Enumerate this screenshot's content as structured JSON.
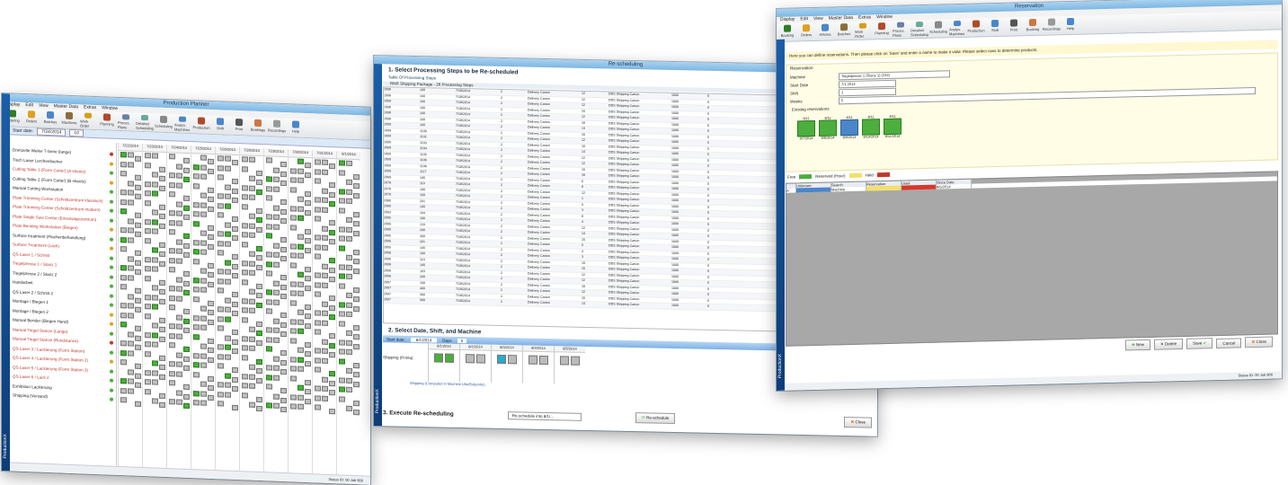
{
  "left_window": {
    "title": "Production Planner",
    "menu": [
      "Display",
      "Edit",
      "View",
      "Master Data",
      "Extras",
      "Window"
    ],
    "ribbon": [
      {
        "label": "Ordering",
        "color": "#2e7d25"
      },
      {
        "label": "Orders",
        "color": "#e0a020"
      },
      {
        "label": "Batches",
        "color": "#4b86c9"
      },
      {
        "label": "Machines",
        "color": "#8a6d3b"
      },
      {
        "label": "Work Order",
        "color": "#d4a017"
      },
      {
        "label": "Planning",
        "color": "#b04a2a"
      },
      {
        "label": "Proces. Plans",
        "color": "#6a7fa6"
      },
      {
        "label": "Detailed Scheduling",
        "color": "#6a9"
      },
      {
        "label": "Scheduling",
        "color": "#888"
      },
      {
        "label": "Analys. Machines",
        "color": "#4b86c9"
      },
      {
        "label": "Production",
        "color": "#b04a2a"
      },
      {
        "label": "Shift",
        "color": "#4b86c9"
      },
      {
        "label": "Print",
        "color": "#555"
      },
      {
        "label": "Bookings",
        "color": "#c74"
      },
      {
        "label": "Recordings",
        "color": "#999"
      },
      {
        "label": "Help",
        "color": "#4b86c9"
      }
    ],
    "toolbar": {
      "start_label": "Start date:",
      "start_value": "7/24/2014",
      "days_value": "10"
    },
    "dates": [
      "7/22/2014",
      "7/23/2014",
      "7/24/2014",
      "7/25/2014",
      "7/26/2014",
      "7/28/2014",
      "7/29/2014",
      "7/30/2014",
      "7/31/2014",
      "8/1/2014"
    ],
    "rows": [
      {
        "label": "Drehzelle Weiler T-Serie (lange)",
        "red": false,
        "dot": "#c0392b"
      },
      {
        "label": "Tisch Laser Lerchenbacher",
        "red": false,
        "dot": "#e0a020"
      },
      {
        "label": "Cutting Table 1 (Form Cutter) (A sheets)",
        "red": true,
        "dot": "#4cae3c"
      },
      {
        "label": "Cutting Table 2 (Form Cutter) (B sheets)",
        "red": false,
        "dot": "#e0a020"
      },
      {
        "label": "Manual Cutting Workstation",
        "red": false,
        "dot": "#4cae3c"
      },
      {
        "label": "Plate Trimming Center (Schnittzentrum klassisch)",
        "red": true,
        "dot": "#4cae3c"
      },
      {
        "label": "Plate Trimming Center (Schnittzentrum modern)",
        "red": true,
        "dot": "#4cae3c"
      },
      {
        "label": "Plate Single Saw Center (Einzelsägezentrum)",
        "red": true,
        "dot": "#4cae3c"
      },
      {
        "label": "Plate Bending Workstation (Biegen)",
        "red": true,
        "dot": "#e0a020"
      },
      {
        "label": "Surface treatment (Flachenbehandlung)",
        "red": false,
        "dot": "#4cae3c"
      },
      {
        "label": "Surface Treatment (Lack)",
        "red": true,
        "dot": "#e0a020"
      },
      {
        "label": "QS Laser 1 / Schnitt",
        "red": true,
        "dot": "#4cae3c"
      },
      {
        "label": "Tiegelpresse 1 / Stanz 1",
        "red": true,
        "dot": "#4cae3c"
      },
      {
        "label": "Tiegelpresse 2 / Stanz 2",
        "red": false,
        "dot": "#4cae3c"
      },
      {
        "label": "Handarbeit",
        "red": false,
        "dot": "#4cae3c"
      },
      {
        "label": "QS Laser 2 / Schnitt 2",
        "red": false,
        "dot": "#4cae3c"
      },
      {
        "label": "Montage / Biegen 1",
        "red": false,
        "dot": "#4cae3c"
      },
      {
        "label": "Montage / Biegen 2",
        "red": false,
        "dot": "#e0a020"
      },
      {
        "label": "Manual Bender (Biegen Hand)",
        "red": false,
        "dot": "#e0a020"
      },
      {
        "label": "Manual Tiegel Stanze (Lange)",
        "red": true,
        "dot": "#4cae3c"
      },
      {
        "label": "Manual Tiegel Stanze (Rundstanze)",
        "red": true,
        "dot": "#c0392b"
      },
      {
        "label": "QS Laser 3 / Lackierung (Form Station)",
        "red": true,
        "dot": "#4cae3c"
      },
      {
        "label": "QS Laser 4 / Lackierung (Form Station 2)",
        "red": true,
        "dot": "#e0a020"
      },
      {
        "label": "QS Laser 5 / Lackierung (Form Station 3)",
        "red": true,
        "dot": "#4cae3c"
      },
      {
        "label": "QS Laser 6 / Lack 2",
        "red": true,
        "dot": "#4cae3c"
      },
      {
        "label": "Exhibition Lackierung",
        "red": false,
        "dot": "#4cae3c"
      },
      {
        "label": "Shipping (Versand)",
        "red": false,
        "dot": "#4cae3c"
      }
    ],
    "sidebar_label": "ProductionX",
    "status": "Status ID: 00   Job 800"
  },
  "middle_window": {
    "title": "Re-scheduling",
    "section1": "1. Select Processing Steps to be Re-scheduled",
    "tab1": "Table Of Processing Steps",
    "group": "RNR Shipping Package - 26 Processing Steps",
    "columns": [
      "ID",
      "Qty",
      "Date",
      "Shift",
      "Machine",
      "Count",
      "Order",
      "Work Step",
      "Time",
      "Flag"
    ],
    "rows": [
      [
        "1006",
        "100",
        "7/18/2014",
        "2",
        "Delivery Carton",
        "12",
        "DDS Shipping Carton",
        "1000",
        "0"
      ],
      [
        "1008",
        "100",
        "7/18/2014",
        "2",
        "Delivery Carton",
        "12",
        "DDS Shipping Carton",
        "1000",
        "0"
      ],
      [
        "1009",
        "100",
        "7/18/2014",
        "2",
        "Delivery Carton",
        "12",
        "DDS Shipping Carton",
        "1000",
        "0"
      ],
      [
        "1008",
        "100",
        "7/18/2014",
        "2",
        "Delivery Carton",
        "15",
        "DDS Shipping Carton",
        "1000",
        "0"
      ],
      [
        "1008",
        "100",
        "7/18/2014",
        "2",
        "Delivery Carton",
        "12",
        "DDS Shipping Carton",
        "1000",
        "0"
      ],
      [
        "1008",
        "100",
        "7/18/2014",
        "2",
        "Delivery Carton",
        "16",
        "DDS Shipping Carton",
        "1000",
        "0"
      ],
      [
        "1009",
        "100",
        "7/18/2014",
        "2",
        "Delivery Carton",
        "13",
        "DDS Shipping Carton",
        "1000",
        "0"
      ],
      [
        "1009",
        "1100",
        "7/18/2014",
        "2",
        "Delivery Carton",
        "16",
        "DDS Shipping Carton",
        "1000",
        "0"
      ],
      [
        "1009",
        "1102",
        "7/18/2014",
        "2",
        "Delivery Carton",
        "12",
        "DDS Shipping Carton",
        "1000",
        "0"
      ],
      [
        "1009",
        "1103",
        "7/18/2014",
        "2",
        "Delivery Carton",
        "16",
        "DDS Shipping Carton",
        "1000",
        "0"
      ],
      [
        "1009",
        "1104",
        "7/18/2014",
        "2",
        "Delivery Carton",
        "14",
        "DDS Shipping Carton",
        "1000",
        "0"
      ],
      [
        "1009",
        "1105",
        "7/18/2014",
        "2",
        "Delivery Carton",
        "12",
        "DDS Shipping Carton",
        "1000",
        "0"
      ],
      [
        "1009",
        "1106",
        "7/18/2014",
        "2",
        "Delivery Carton",
        "12",
        "DDS Shipping Carton",
        "1000",
        "0"
      ],
      [
        "1009",
        "1108",
        "7/18/2014",
        "2",
        "Delivery Carton",
        "15",
        "DDS Shipping Carton",
        "1000",
        "0"
      ],
      [
        "1009",
        "1117",
        "7/18/2014",
        "2",
        "Delivery Carton",
        "16",
        "DDS Shipping Carton",
        "1000",
        "0"
      ],
      [
        "2069",
        "105",
        "7/18/2014",
        "2",
        "Delivery Carton",
        "5",
        "DDS Shipping Carton",
        "1000",
        "0"
      ],
      [
        "2076",
        "110",
        "7/18/2014",
        "2",
        "Delivery Carton",
        "6",
        "DDS Shipping Carton",
        "1000",
        "0"
      ],
      [
        "2076",
        "100",
        "7/18/2014",
        "2",
        "Delivery Carton",
        "12",
        "DDS Shipping Carton",
        "1000",
        "0"
      ],
      [
        "2076",
        "150",
        "7/18/2014",
        "2",
        "Delivery Carton",
        "1",
        "DDS Shipping Carton",
        "1000",
        "0"
      ],
      [
        "2080",
        "201",
        "7/18/2014",
        "2",
        "Delivery Carton",
        "5",
        "DDS Shipping Carton",
        "1000",
        "0"
      ],
      [
        "2000",
        "100",
        "7/18/2014",
        "2",
        "Delivery Carton",
        "3",
        "DDS Shipping Carton",
        "1000",
        "0"
      ],
      [
        "2003",
        "104",
        "7/18/2014",
        "2",
        "Delivery Carton",
        "8",
        "DDS Shipping Carton",
        "1000",
        "0"
      ],
      [
        "2005",
        "100",
        "7/18/2014",
        "2",
        "Delivery Carton",
        "4",
        "DDS Shipping Carton",
        "1000",
        "0"
      ],
      [
        "2005",
        "120",
        "7/18/2014",
        "2",
        "Delivery Carton",
        "12",
        "DDS Shipping Carton",
        "1000",
        "0"
      ],
      [
        "2000",
        "200",
        "7/18/2014",
        "2",
        "Delivery Carton",
        "14",
        "DDS Shipping Carton",
        "1000",
        "0"
      ],
      [
        "2005",
        "300",
        "7/18/2014",
        "2",
        "Delivery Carton",
        "15",
        "DDS Shipping Carton",
        "1000",
        "0"
      ],
      [
        "2005",
        "201",
        "7/18/2014",
        "2",
        "Delivery Carton",
        "5",
        "DDS Shipping Carton",
        "1000",
        "0"
      ],
      [
        "2005",
        "105",
        "7/18/2014",
        "2",
        "Delivery Carton",
        "4",
        "DDS Shipping Carton",
        "1000",
        "0"
      ],
      [
        "2006",
        "100",
        "7/18/2014",
        "2",
        "Delivery Carton",
        "3",
        "DDS Shipping Carton",
        "1000",
        "0"
      ],
      [
        "2006",
        "110",
        "7/18/2014",
        "2",
        "Delivery Carton",
        "10",
        "DDS Shipping Carton",
        "1000",
        "0"
      ],
      [
        "2006",
        "105",
        "7/18/2014",
        "2",
        "Delivery Carton",
        "15",
        "DDS Shipping Carton",
        "1000",
        "0"
      ],
      [
        "2006",
        "103",
        "7/18/2014",
        "2",
        "Delivery Carton",
        "12",
        "DDS Shipping Carton",
        "1000",
        "0"
      ],
      [
        "2006",
        "200",
        "7/18/2014",
        "2",
        "Delivery Carton",
        "12",
        "DDS Shipping Carton",
        "1000",
        "0"
      ],
      [
        "2007",
        "100",
        "7/18/2014",
        "2",
        "Delivery Carton",
        "16",
        "DDS Shipping Carton",
        "1000",
        "0"
      ],
      [
        "2007",
        "400",
        "7/18/2014",
        "2",
        "Delivery Carton",
        "12",
        "DDS Shipping Carton",
        "1000",
        "0"
      ],
      [
        "2007",
        "300",
        "7/18/2014",
        "2",
        "Delivery Carton",
        "15",
        "DDS Shipping Carton",
        "1000",
        "0"
      ],
      [
        "2007",
        "560",
        "7/18/2014",
        "2",
        "Delivery Carton",
        "14",
        "DDS Shipping Carton",
        "1000",
        "0"
      ]
    ],
    "section2": "2. Select Date, Shift, and Machine",
    "start_label": "Start date:",
    "start_value": "8/1/2014",
    "days_label": "Days",
    "days_value": "5",
    "machine_label": "Shipping (Printa)",
    "dates": [
      "8/1/2014",
      "8/2/2014",
      "8/3/2014",
      "8/4/2014",
      "8/5/2014"
    ],
    "note": "Shipping (Computed in Machine Ulm/Bubenho)",
    "section3": "3. Execute Re-scheduling",
    "combo_value": "Re-schedule into 8/1/...",
    "execute_label": "Re-schedule",
    "close_label": "Close",
    "sidebar_label": "ProductionX"
  },
  "right_window": {
    "title": "Reservation",
    "menu": [
      "Display",
      "Edit",
      "View",
      "Master Data",
      "Extras",
      "Window"
    ],
    "ribbon": [
      "Booking",
      "Orders",
      "Articles",
      "Batches",
      "Work Order",
      "Planning",
      "Proces. Plans",
      "Detailed Scheduling",
      "Scheduling",
      "Analys. Machines",
      "Production",
      "Shift",
      "Print",
      "Booking",
      "Recordings",
      "Help"
    ],
    "hint": "Here you can define reservations. Then please click on 'Save' and enter a name to make it valid. Please select rows to determine products.",
    "section": "Reservation",
    "fields": [
      {
        "label": "Machine",
        "value": "Tiegelpresse 1 (Stanz 1) (232)"
      },
      {
        "label": "Start Date",
        "value": "7/1 2014"
      },
      {
        "label": "Shift",
        "value": "1"
      },
      {
        "label": "Weeks",
        "value": "5"
      }
    ],
    "existing_label": "Existing reservations",
    "slots": [
      {
        "top": "8/11",
        "date": "8/7/2014",
        "sel": false
      },
      {
        "top": "8/11",
        "date": "8/8/2014",
        "sel": false
      },
      {
        "top": "8/11",
        "date": "8/9/2014",
        "sel": true
      },
      {
        "top": "8/11",
        "date": "8/10/2014",
        "sel": false
      },
      {
        "top": "8/11",
        "date": "8/11/2014",
        "sel": false
      }
    ],
    "legend": {
      "free": "Free",
      "reserved": "Reserved (Hour)",
      "held": "Held",
      "full": "Full"
    },
    "columns": [
      "",
      "Unknown",
      "Search",
      "Reservation",
      "Used",
      "Since Date"
    ],
    "table_row": [
      "A",
      "",
      "Machine",
      "",
      "",
      "8/5/2014"
    ],
    "buttons": {
      "new": "New",
      "delete": "Delete",
      "save": "Save",
      "cancel": "Cancel",
      "close": "Close"
    },
    "sidebar_label": "ProductionX",
    "status": "Status ID: 00   Job 800"
  },
  "colors": {
    "green": "#4cae3c",
    "blue_title": "#7fb7e2",
    "yellow": "#f3e06a",
    "red": "#c0392b"
  }
}
